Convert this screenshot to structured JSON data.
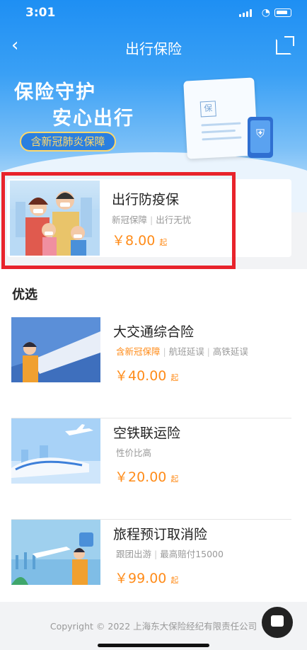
{
  "status_bar": {
    "time": "3:01"
  },
  "nav": {
    "title": "出行保险"
  },
  "hero": {
    "slogan_line1": "保险守护",
    "slogan_line2": "安心出行",
    "covid_tag": "含新冠肺炎保障",
    "doc_char": "保"
  },
  "featured": {
    "title": "出行防疫保",
    "subtitle_parts": [
      "新冠保障",
      "出行无忧"
    ],
    "price": "￥8.00",
    "price_suffix": "起"
  },
  "section": {
    "title": "优选"
  },
  "products": [
    {
      "title": "大交通综合险",
      "tags": [
        "含新冠保障",
        "航班延误",
        "高铁延误"
      ],
      "highlight_first": true,
      "price": "￥40.00",
      "price_suffix": "起"
    },
    {
      "title": "空铁联运险",
      "tags": [
        "性价比高"
      ],
      "highlight_first": false,
      "price": "￥20.00",
      "price_suffix": "起"
    },
    {
      "title": "旅程预订取消险",
      "tags": [
        "跟团出游",
        "最高赔付15000"
      ],
      "highlight_first": false,
      "price": "￥99.00",
      "price_suffix": "起"
    }
  ],
  "footer": {
    "copyright": "Copyright © 2022 上海东大保险经纪有限责任公司"
  },
  "colors": {
    "brand_blue": "#1e8ff3",
    "accent_orange": "#ff8c1a",
    "annotation_red": "#e8232b"
  },
  "icons": [
    "back-arrow-icon",
    "share-icon",
    "wifi-icon",
    "signal-icon",
    "battery-icon",
    "shield-icon",
    "chat-icon"
  ]
}
